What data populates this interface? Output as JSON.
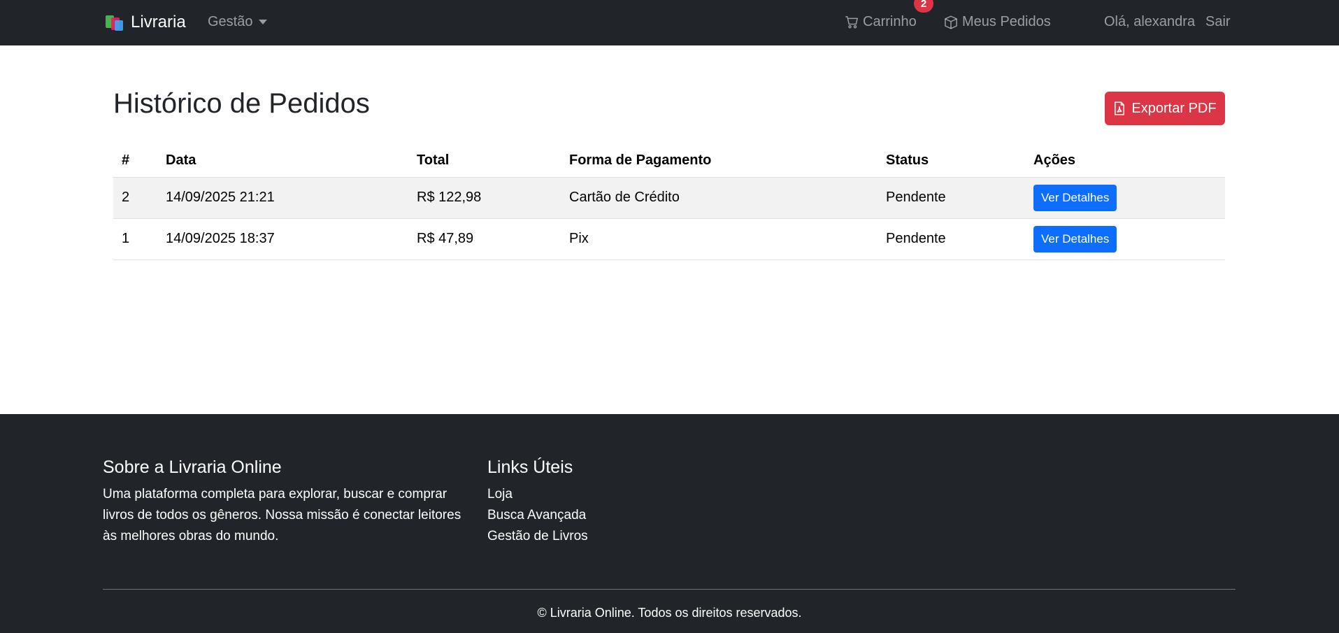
{
  "navbar": {
    "brand": "Livraria",
    "gestao_label": "Gestão",
    "cart_label": "Carrinho",
    "cart_count": "2",
    "orders_label": "Meus Pedidos",
    "greeting": "Olá, alexandra",
    "logout_label": "Sair"
  },
  "main": {
    "title": "Histórico de Pedidos",
    "export_label": "Exportar PDF",
    "columns": [
      "#",
      "Data",
      "Total",
      "Forma de Pagamento",
      "Status",
      "Ações"
    ],
    "rows": [
      {
        "id": "2",
        "date": "14/09/2025 21:21",
        "total": "R$ 122,98",
        "payment": "Cartão de Crédito",
        "status": "Pendente",
        "action": "Ver Detalhes"
      },
      {
        "id": "1",
        "date": "14/09/2025 18:37",
        "total": "R$ 47,89",
        "payment": "Pix",
        "status": "Pendente",
        "action": "Ver Detalhes"
      }
    ]
  },
  "footer": {
    "about_title": "Sobre a Livraria Online",
    "about_text": "Uma plataforma completa para explorar, buscar e comprar livros de todos os gêneros. Nossa missão é conectar leitores às melhores obras do mundo.",
    "links_title": "Links Úteis",
    "links": [
      "Loja",
      "Busca Avançada",
      "Gestão de Livros"
    ],
    "copyright": "© Livraria Online. Todos os direitos reservados."
  },
  "colors": {
    "navbar_bg": "#212529",
    "danger": "#dc3545",
    "primary": "#0d6efd"
  },
  "icons": [
    "book-logo-icon",
    "cart-icon",
    "box-icon",
    "pdf-icon",
    "caret-down-icon"
  ]
}
